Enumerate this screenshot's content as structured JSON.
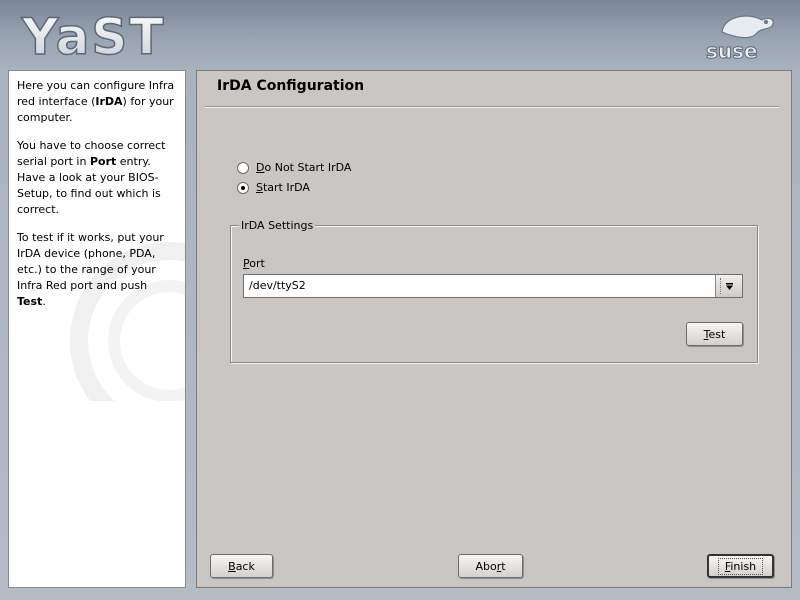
{
  "branding": {
    "app_logo_text": "YaST",
    "vendor_logo_text": "suse"
  },
  "help": {
    "p1": {
      "a": "Here you can configure Infra red interface (",
      "b": "IrDA",
      "c": ") for your computer."
    },
    "p2": {
      "a": "You have to choose correct serial port in ",
      "b": "Port",
      "c": " entry. Have a look at your BIOS-Setup, to find out which is correct."
    },
    "p3": {
      "a": "To test if it works, put your IrDA device (phone, PDA, etc.) to the range of your Infra Red port and push ",
      "b": "Test",
      "c": "."
    }
  },
  "main": {
    "title": "IrDA Configuration",
    "radios": [
      {
        "first": "D",
        "rest": "o Not Start IrDA",
        "selected": false
      },
      {
        "first": "S",
        "rest": "tart IrDA",
        "selected": true
      }
    ],
    "settings": {
      "legend": "IrDA Settings",
      "port_label_first": "P",
      "port_label_rest": "ort",
      "port_value": "/dev/ttyS2",
      "test_first": "T",
      "test_rest": "est"
    }
  },
  "buttons": {
    "back_first": "B",
    "back_rest": "ack",
    "abort_a": "Abo",
    "abort_u": "r",
    "abort_b": "t",
    "finish_first": "F",
    "finish_rest": "inish"
  }
}
